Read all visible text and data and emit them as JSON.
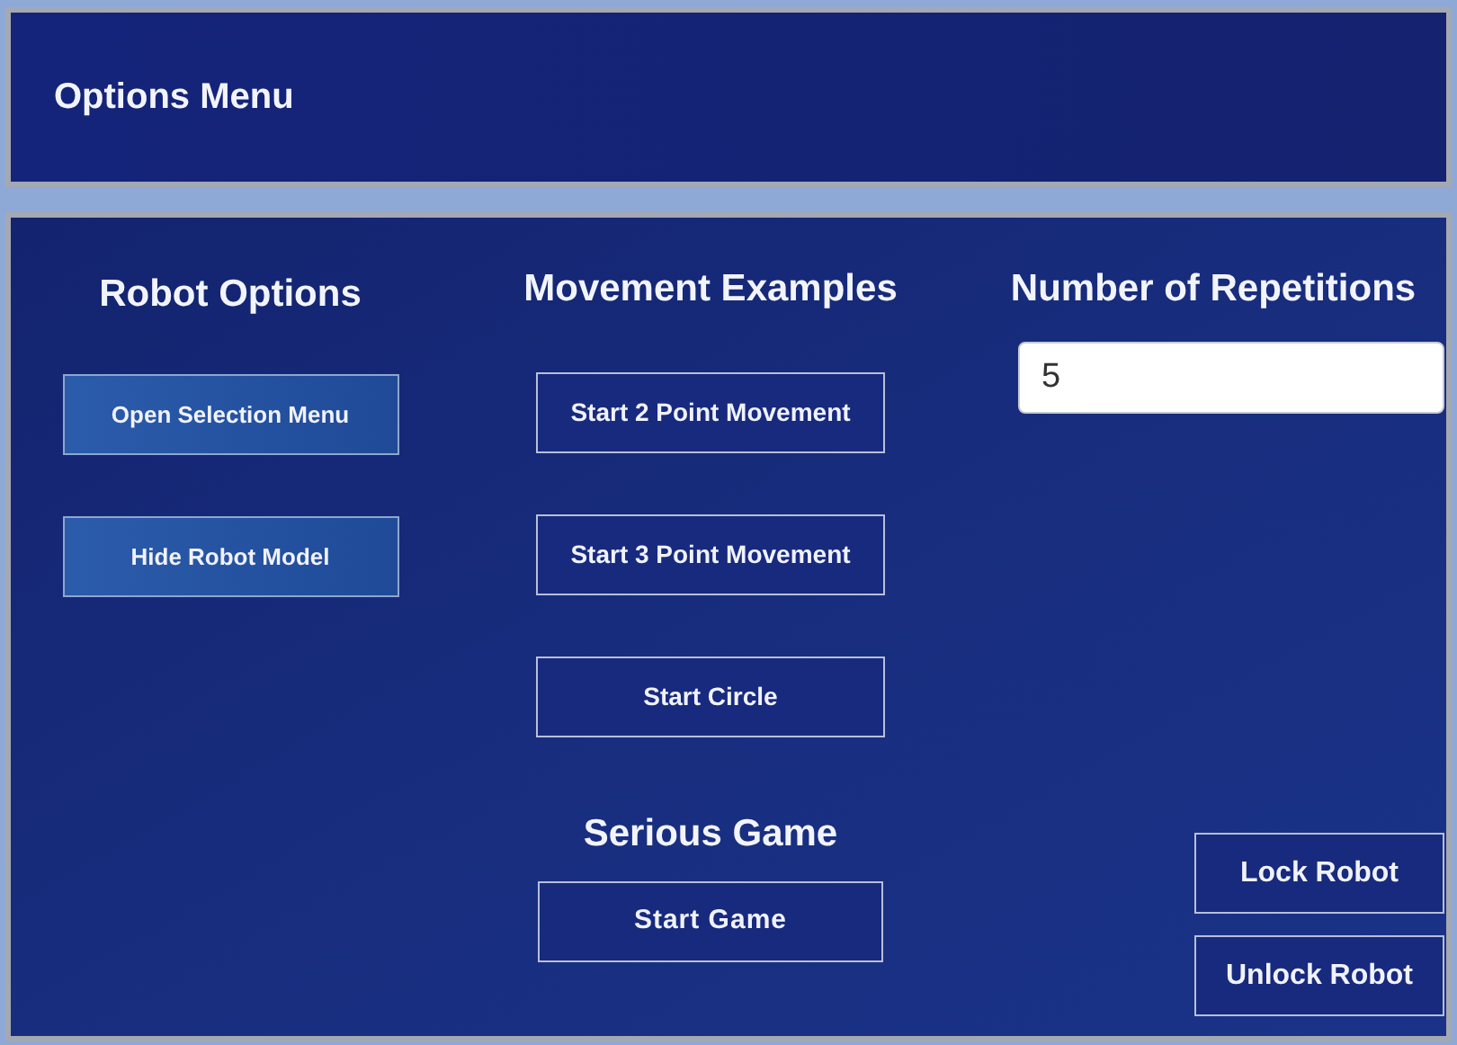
{
  "header": {
    "title": "Options Menu"
  },
  "robot_options": {
    "title": "Robot Options",
    "buttons": [
      {
        "label": "Open Selection Menu",
        "kind": "light"
      },
      {
        "label": "Hide Robot Model",
        "kind": "light"
      }
    ]
  },
  "movement_examples": {
    "title": "Movement Examples",
    "buttons": [
      {
        "label": "Start 2 Point Movement",
        "kind": "dark"
      },
      {
        "label": "Start 3 Point Movement",
        "kind": "dark"
      },
      {
        "label": "Start Circle",
        "kind": "dark"
      }
    ]
  },
  "serious_game": {
    "title": "Serious Game",
    "button": {
      "label": "Start Game",
      "kind": "dark"
    }
  },
  "repetitions": {
    "title": "Number of Repetitions",
    "value": "5"
  },
  "lock_buttons": [
    {
      "label": "Lock Robot",
      "kind": "dark"
    },
    {
      "label": "Unlock Robot",
      "kind": "dark"
    }
  ]
}
